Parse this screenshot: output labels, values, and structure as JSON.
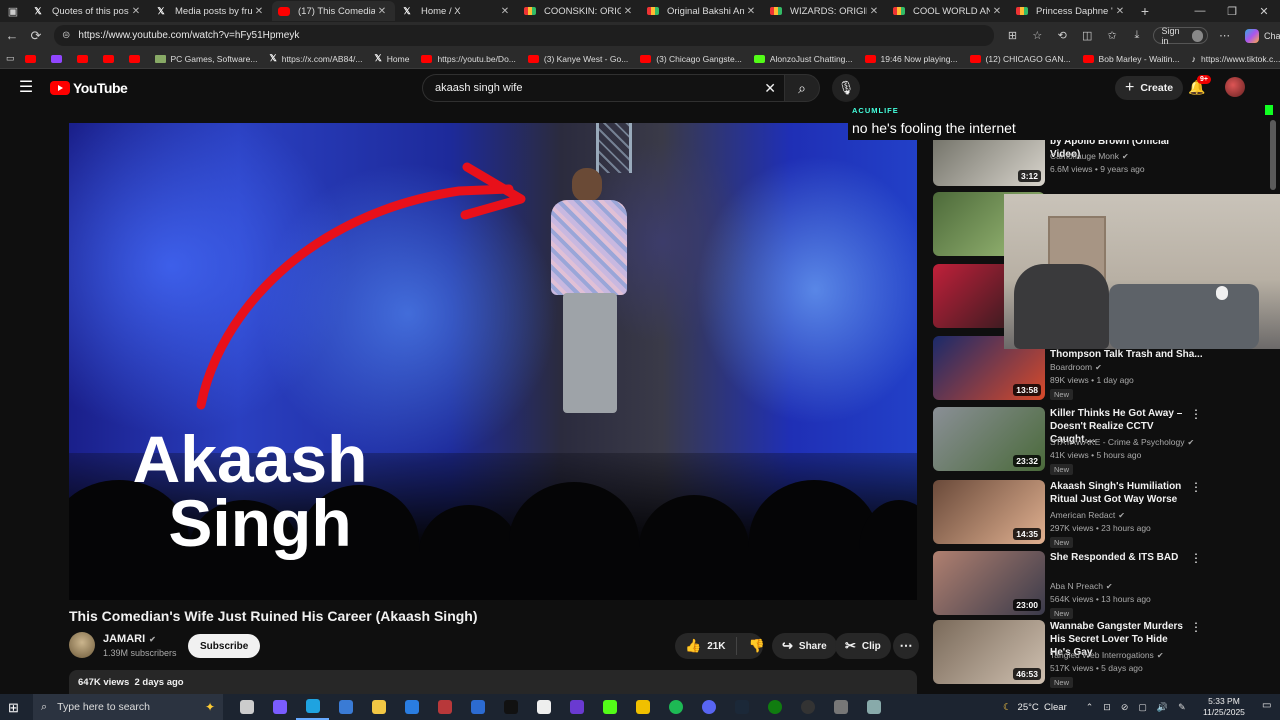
{
  "browser": {
    "tabs": [
      {
        "icon": "x",
        "title": "Quotes of this post / X"
      },
      {
        "icon": "x",
        "title": "Media posts by frutta"
      },
      {
        "icon": "youtube",
        "title": "(17) This Comedian's W"
      },
      {
        "icon": "x",
        "title": "Home / X"
      },
      {
        "icon": "rainbow",
        "title": "COONSKIN: ORIGINAL"
      },
      {
        "icon": "rainbow",
        "title": "Original Bakshi Animat"
      },
      {
        "icon": "rainbow",
        "title": "WIZARDS: ORIGINAL A"
      },
      {
        "icon": "rainbow",
        "title": "COOL WORLD ANIMA"
      },
      {
        "icon": "rainbow",
        "title": "Princess Daphne \"Drag"
      }
    ],
    "url": "https://www.youtube.com/watch?v=hFy51Hpmeyk",
    "signin_label": "Sign in",
    "chat_label": "Chat",
    "bookmarks": [
      {
        "icon": "yt",
        "label": ""
      },
      {
        "icon": "twitch",
        "label": ""
      },
      {
        "icon": "yt",
        "label": ""
      },
      {
        "icon": "yt",
        "label": ""
      },
      {
        "icon": "yt",
        "label": ""
      },
      {
        "icon": "pc",
        "label": "PC Games, Software..."
      },
      {
        "icon": "x",
        "label": "https://x.com/AB84/..."
      },
      {
        "icon": "x",
        "label": "Home"
      },
      {
        "icon": "yt",
        "label": "https://youtu.be/Do..."
      },
      {
        "icon": "yt",
        "label": "(3) Kanye West - Go..."
      },
      {
        "icon": "yt",
        "label": "(3) Chicago Gangste..."
      },
      {
        "icon": "kick",
        "label": "AlonzoJust Chatting..."
      },
      {
        "icon": "yt",
        "label": "19:46 Now playing..."
      },
      {
        "icon": "yt",
        "label": "(12) CHICAGO GAN..."
      },
      {
        "icon": "yt",
        "label": "Bob Marley - Waitin..."
      },
      {
        "icon": "tiktok",
        "label": "https://www.tiktok.c..."
      }
    ]
  },
  "youtube": {
    "logo_text": "YouTube",
    "search_value": "akaash singh wife",
    "create_label": "Create",
    "notif_badge": "9+",
    "video": {
      "thumbnail_text_line1": "Akaash",
      "thumbnail_text_line2": "Singh",
      "title": "This Comedian's Wife Just Ruined His Career (Akaash Singh)",
      "channel": "JAMARI",
      "subscribers": "1.39M subscribers",
      "subscribe_label": "Subscribe",
      "likes": "21K",
      "share_label": "Share",
      "clip_label": "Clip",
      "views_date": "647K views  2 days ago"
    },
    "sidebar": [
      {
        "title": "WestSideGunn - Mr. T prod by Apollo Brown (Official Video)",
        "channel": "Camoflauge Monk",
        "meta": "6.6M views • 9 years ago",
        "duration": "3:12",
        "new": "",
        "thumb": [
          "#6a6a60",
          "#d8d4cc"
        ]
      },
      {
        "title": "",
        "channel": "",
        "meta": "",
        "duration": "",
        "new": "",
        "thumb": [
          "#4d6a3a",
          "#9fbf7a"
        ]
      },
      {
        "title": "",
        "channel": "",
        "meta": "",
        "duration": "",
        "new": "",
        "thumb": [
          "#c0203a",
          "#1a1a1a"
        ]
      },
      {
        "title": "Thompson Talk Trash and Sha...",
        "channel": "Boardroom",
        "meta": "89K views • 1 day ago",
        "duration": "13:58",
        "new": "New",
        "thumb": [
          "#1a2a6a",
          "#d84a2a"
        ]
      },
      {
        "title": "Killer Thinks He Got Away – Doesn't Realize CCTV Caught ...",
        "channel": "STAYAWAKE - Crime & Psychology",
        "meta": "41K views • 5 hours ago",
        "duration": "23:32",
        "new": "New",
        "thumb": [
          "#8a8f96",
          "#4a6a3a"
        ]
      },
      {
        "title": "Akaash Singh's Humiliation Ritual Just Got Way Worse",
        "channel": "American Redact",
        "meta": "297K views • 23 hours ago",
        "duration": "14:35",
        "new": "New",
        "thumb": [
          "#6a4a3a",
          "#e0b090"
        ]
      },
      {
        "title": "She Responded & ITS BAD",
        "channel": "Aba N Preach",
        "meta": "564K views • 13 hours ago",
        "duration": "23:00",
        "new": "New",
        "thumb": [
          "#b08070",
          "#3a3a4a"
        ]
      },
      {
        "title": "Wannabe Gangster Murders His Secret Lover To Hide He's Gay",
        "channel": "Tangled Web Interrogations",
        "meta": "517K views • 5 days ago",
        "duration": "46:53",
        "new": "New",
        "thumb": [
          "#7a6a5a",
          "#cfc0b0"
        ]
      }
    ]
  },
  "overlay": {
    "tag": "ACUMLIFE",
    "caption": "no he's fooling the internet"
  },
  "taskbar": {
    "search_placeholder": "Type here to search",
    "weather": "25°C  Clear",
    "time": "5:33 PM",
    "date": "11/25/2025",
    "pinned": [
      "task-view",
      "copilot",
      "edge",
      "store",
      "file-explorer",
      "mail",
      "app-red",
      "app-blue",
      "app-meow",
      "app-white",
      "app-purple",
      "kick",
      "app-yellow",
      "spotify",
      "discord",
      "steam",
      "xbox",
      "github",
      "app-gray",
      "app-shield"
    ]
  },
  "colors": {
    "accent": "#ff0000",
    "background": "#0f0f0f",
    "pill": "#272727"
  }
}
